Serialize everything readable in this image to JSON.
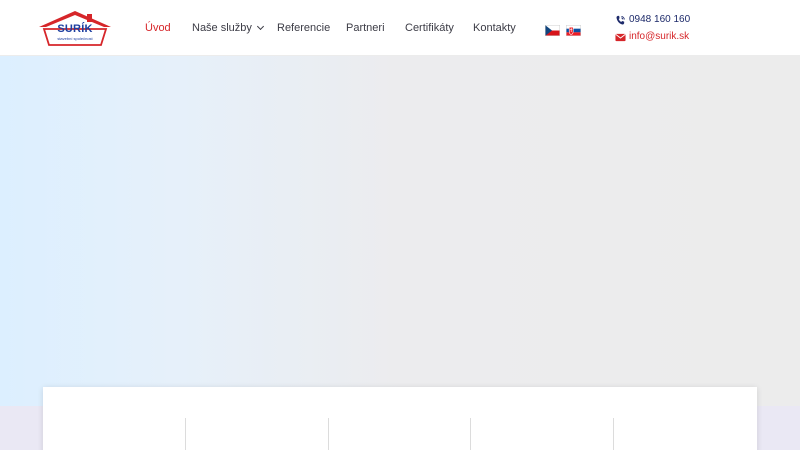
{
  "logo": {
    "word": "SURÍK",
    "subtitle": "stavební společnost",
    "colors": {
      "roof": "#d6262a",
      "text": "#1d3fa0"
    }
  },
  "nav": {
    "items": [
      {
        "label": "Úvod",
        "active": true
      },
      {
        "label": "Naše služby",
        "has_dropdown": true
      },
      {
        "label": "Referencie"
      },
      {
        "label": "Partneri"
      },
      {
        "label": "Certifikáty"
      },
      {
        "label": "Kontakty"
      }
    ]
  },
  "languages": [
    {
      "code": "cz",
      "icon": "czech-flag-icon"
    },
    {
      "code": "sk",
      "icon": "slovak-flag-icon"
    }
  ],
  "contact": {
    "phone": "0948 160 160",
    "email": "info@surik.sk",
    "phone_icon": "phone-icon",
    "email_icon": "envelope-icon"
  },
  "colors": {
    "accent": "#d6262a",
    "nav_text": "#3c3c46",
    "phone_text": "#1d2a6a"
  }
}
